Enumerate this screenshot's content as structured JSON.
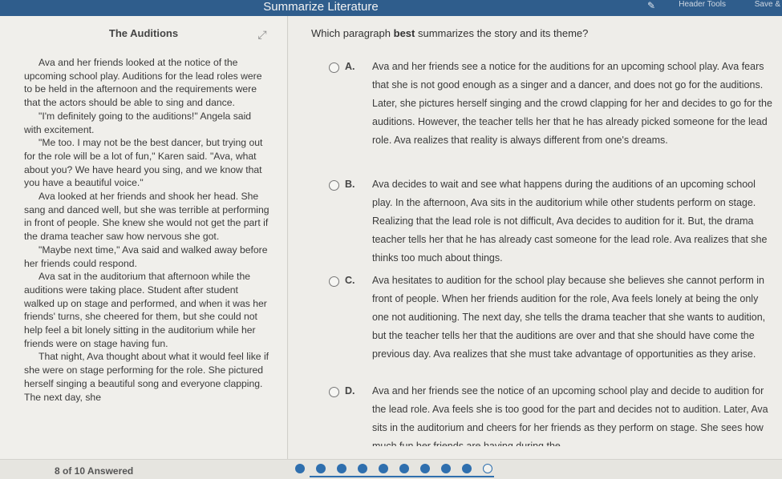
{
  "topbar": {
    "title": "Summarize Literature",
    "header_tools": "Header Tools",
    "save": "Save &"
  },
  "passage": {
    "title": "The Auditions",
    "paragraphs": [
      "Ava and her friends looked at the notice of the upcoming school play. Auditions for the lead roles were to be held in the afternoon and the requirements were that the actors should be able to sing and dance.",
      "\"I'm definitely going to the auditions!\" Angela said with excitement.",
      "\"Me too. I may not be the best dancer, but trying out for the role will be a lot of fun,\" Karen said. \"Ava, what about you? We have heard you sing, and we know that you have a beautiful voice.\"",
      "Ava looked at her friends and shook her head. She sang and danced well, but she was terrible at performing in front of people. She knew she would not get the part if the drama teacher saw how nervous she got.",
      "\"Maybe next time,\" Ava said and walked away before her friends could respond.",
      "Ava sat in the auditorium that afternoon while the auditions were taking place. Student after student walked up on stage and performed, and when it was her friends' turns, she cheered for them, but she could not help feel a bit lonely sitting in the auditorium while her friends were on stage having fun.",
      "That night, Ava thought about what it would feel like if she were on stage performing for the role. She pictured herself singing a beautiful song and everyone clapping. The next day, she"
    ]
  },
  "question": {
    "prefix": "Which paragraph ",
    "bold": "best",
    "suffix": " summarizes the story and its theme?"
  },
  "options": [
    {
      "label": "A.",
      "text": "Ava and her friends see a notice for the auditions for an upcoming school play. Ava fears that she is not good enough as a singer and a dancer, and does not go for the auditions. Later, she pictures herself singing and the crowd clapping for her and decides to go for the auditions. However, the teacher tells her that he has already picked someone for the lead role. Ava realizes that reality is always different from one's dreams."
    },
    {
      "label": "B.",
      "text": "Ava decides to wait and see what happens during the auditions of an upcoming school play. In the afternoon, Ava sits in the auditorium while other students perform on stage. Realizing that the lead role is not difficult, Ava decides to audition for it. But, the drama teacher tells her that he has already cast someone for the lead role. Ava realizes that she thinks too much about things."
    },
    {
      "label": "C.",
      "text": "Ava hesitates to audition for the school play because she believes she cannot perform in front of people. When her friends audition for the role, Ava feels lonely at being the only one not auditioning. The next day, she tells the drama teacher that she wants to audition, but the teacher tells her that the auditions are over and that she should have come the previous day. Ava realizes that she must take advantage of opportunities as they arise."
    },
    {
      "label": "D.",
      "text": "Ava and her friends see the notice of an upcoming school play and decide to audition for the lead role. Ava feels she is too good for the part and decides not to audition. Later, Ava sits in the auditorium and cheers for her friends as they perform on stage. She sees how much fun her friends are having during the"
    }
  ],
  "footer": {
    "answered": "8 of 10 Answered",
    "total": 10,
    "answered_count": 8,
    "current": 9
  }
}
